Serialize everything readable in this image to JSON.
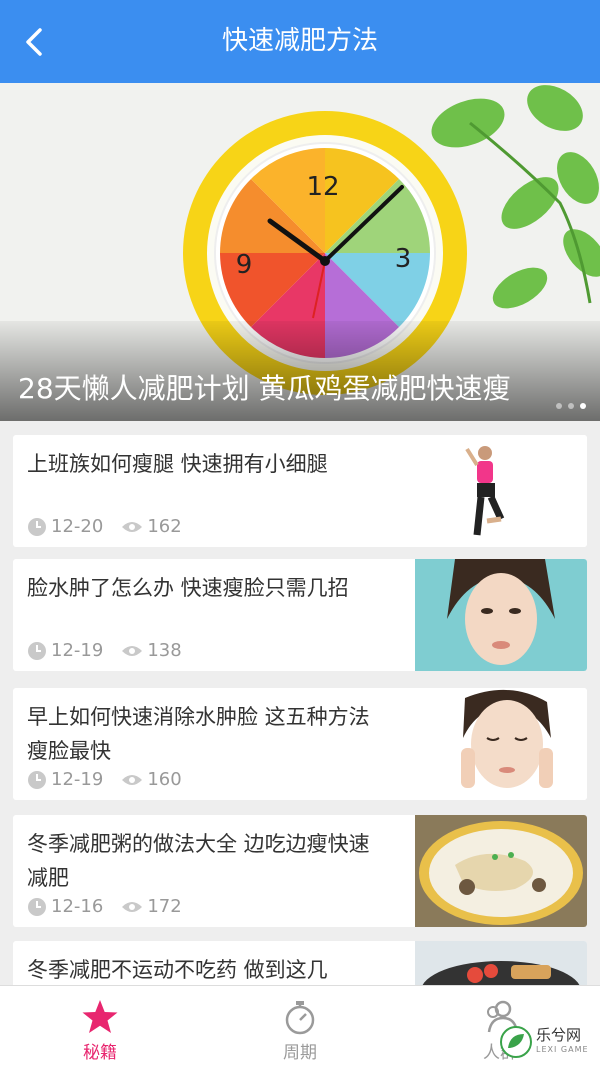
{
  "header": {
    "title": "快速减肥方法"
  },
  "banner": {
    "title": "28天懒人减肥计划 黄瓜鸡蛋减肥快速瘦",
    "clock_numbers": [
      "12",
      "3",
      "9"
    ]
  },
  "articles": [
    {
      "title": "上班族如何瘦腿 快速拥有小细腿",
      "date": "12-20",
      "views": "162"
    },
    {
      "title": "脸水肿了怎么办 快速瘦脸只需几招",
      "date": "12-19",
      "views": "138"
    },
    {
      "title": "早上如何快速消除水肿脸 这五种方法瘦脸最快",
      "date": "12-19",
      "views": "160"
    },
    {
      "title": "冬季减肥粥的做法大全 边吃边瘦快速减肥",
      "date": "12-16",
      "views": "172"
    },
    {
      "title": "冬季减肥不运动不吃药 做到这几",
      "date": "",
      "views": ""
    }
  ],
  "tabs": [
    {
      "label": "秘籍",
      "icon": "star-icon",
      "active": true
    },
    {
      "label": "周期",
      "icon": "stopwatch-icon",
      "active": false
    },
    {
      "label": "人群",
      "icon": "people-icon",
      "active": false
    }
  ],
  "watermark": {
    "text": "乐兮网",
    "sub": "LEXI GAME"
  },
  "colors": {
    "header": "#3b8ef0",
    "active_tab": "#e8266f",
    "inactive_tab": "#9a9a9a"
  }
}
